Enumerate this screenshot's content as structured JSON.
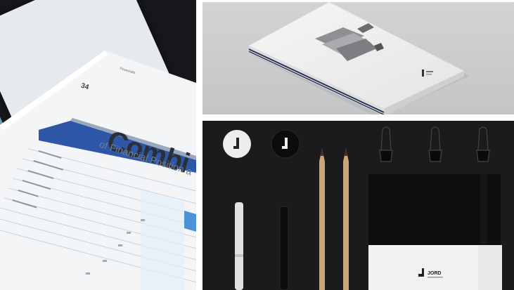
{
  "left_panel": {
    "title": "Combi",
    "subtitle": "of Financial Position a",
    "page_number": "34",
    "header_text": "Financials"
  },
  "stationery_panel": {
    "card_brand": "JORD"
  }
}
